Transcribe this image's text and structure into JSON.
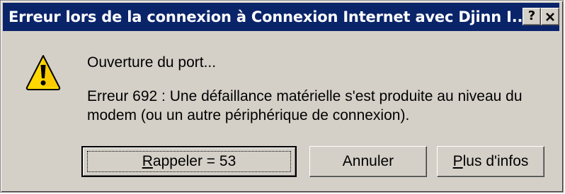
{
  "dialog": {
    "title": "Erreur lors de la connexion à Connexion Internet avec Djinn I...",
    "help_button": "?",
    "close_button": "✕",
    "icon": "warning-icon",
    "message_status": "Ouverture du port...",
    "message_error_line1": "Erreur 692 : Une défaillance matérielle s'est produite au niveau du",
    "message_error_line2": "modem (ou un autre périphérique de connexion).",
    "buttons": {
      "redial_prefix": "R",
      "redial_rest": "appeler = 53",
      "cancel": "Annuler",
      "more_prefix": "P",
      "more_rest": "lus d'infos"
    }
  },
  "colors": {
    "titlebar": "#0a246a",
    "face": "#d4d0c8",
    "warning_yellow": "#ffd800"
  }
}
